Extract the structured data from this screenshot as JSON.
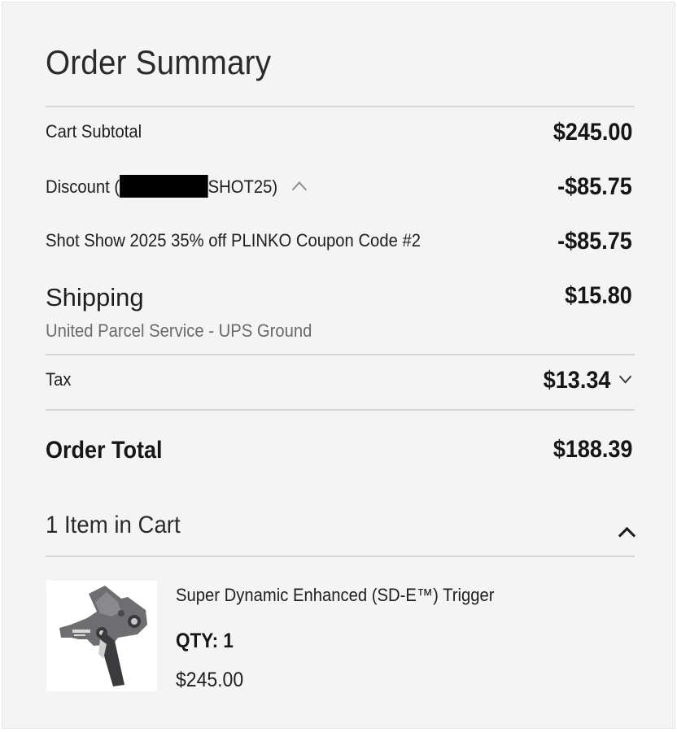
{
  "summary": {
    "title": "Order Summary",
    "subtotal": {
      "label": "Cart Subtotal",
      "value": "$245.00"
    },
    "discount": {
      "label_prefix": "Discount (",
      "label_suffix": "SHOT25)",
      "value": "-$85.75"
    },
    "coupon": {
      "label": "Shot Show 2025 35% off PLINKO Coupon Code #2",
      "value": "-$85.75"
    },
    "shipping": {
      "label": "Shipping",
      "method": "United Parcel Service - UPS Ground",
      "value": "$15.80"
    },
    "tax": {
      "label": "Tax",
      "value": "$13.34"
    },
    "total": {
      "label": "Order Total",
      "value": "$188.39"
    }
  },
  "cart": {
    "heading": "1 Item in Cart",
    "items": [
      {
        "name": "Super Dynamic Enhanced (SD-E™) Trigger",
        "qty": "QTY: 1",
        "price": "$245.00",
        "image_icon": "trigger-product-image"
      }
    ]
  }
}
